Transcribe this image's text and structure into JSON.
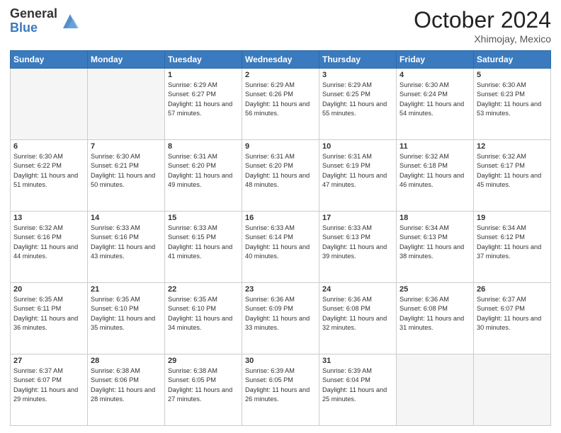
{
  "header": {
    "logo_general": "General",
    "logo_blue": "Blue",
    "month_title": "October 2024",
    "location": "Xhimojay, Mexico"
  },
  "weekdays": [
    "Sunday",
    "Monday",
    "Tuesday",
    "Wednesday",
    "Thursday",
    "Friday",
    "Saturday"
  ],
  "weeks": [
    [
      {
        "day": "",
        "info": ""
      },
      {
        "day": "",
        "info": ""
      },
      {
        "day": "1",
        "info": "Sunrise: 6:29 AM\nSunset: 6:27 PM\nDaylight: 11 hours and 57 minutes."
      },
      {
        "day": "2",
        "info": "Sunrise: 6:29 AM\nSunset: 6:26 PM\nDaylight: 11 hours and 56 minutes."
      },
      {
        "day": "3",
        "info": "Sunrise: 6:29 AM\nSunset: 6:25 PM\nDaylight: 11 hours and 55 minutes."
      },
      {
        "day": "4",
        "info": "Sunrise: 6:30 AM\nSunset: 6:24 PM\nDaylight: 11 hours and 54 minutes."
      },
      {
        "day": "5",
        "info": "Sunrise: 6:30 AM\nSunset: 6:23 PM\nDaylight: 11 hours and 53 minutes."
      }
    ],
    [
      {
        "day": "6",
        "info": "Sunrise: 6:30 AM\nSunset: 6:22 PM\nDaylight: 11 hours and 51 minutes."
      },
      {
        "day": "7",
        "info": "Sunrise: 6:30 AM\nSunset: 6:21 PM\nDaylight: 11 hours and 50 minutes."
      },
      {
        "day": "8",
        "info": "Sunrise: 6:31 AM\nSunset: 6:20 PM\nDaylight: 11 hours and 49 minutes."
      },
      {
        "day": "9",
        "info": "Sunrise: 6:31 AM\nSunset: 6:20 PM\nDaylight: 11 hours and 48 minutes."
      },
      {
        "day": "10",
        "info": "Sunrise: 6:31 AM\nSunset: 6:19 PM\nDaylight: 11 hours and 47 minutes."
      },
      {
        "day": "11",
        "info": "Sunrise: 6:32 AM\nSunset: 6:18 PM\nDaylight: 11 hours and 46 minutes."
      },
      {
        "day": "12",
        "info": "Sunrise: 6:32 AM\nSunset: 6:17 PM\nDaylight: 11 hours and 45 minutes."
      }
    ],
    [
      {
        "day": "13",
        "info": "Sunrise: 6:32 AM\nSunset: 6:16 PM\nDaylight: 11 hours and 44 minutes."
      },
      {
        "day": "14",
        "info": "Sunrise: 6:33 AM\nSunset: 6:16 PM\nDaylight: 11 hours and 43 minutes."
      },
      {
        "day": "15",
        "info": "Sunrise: 6:33 AM\nSunset: 6:15 PM\nDaylight: 11 hours and 41 minutes."
      },
      {
        "day": "16",
        "info": "Sunrise: 6:33 AM\nSunset: 6:14 PM\nDaylight: 11 hours and 40 minutes."
      },
      {
        "day": "17",
        "info": "Sunrise: 6:33 AM\nSunset: 6:13 PM\nDaylight: 11 hours and 39 minutes."
      },
      {
        "day": "18",
        "info": "Sunrise: 6:34 AM\nSunset: 6:13 PM\nDaylight: 11 hours and 38 minutes."
      },
      {
        "day": "19",
        "info": "Sunrise: 6:34 AM\nSunset: 6:12 PM\nDaylight: 11 hours and 37 minutes."
      }
    ],
    [
      {
        "day": "20",
        "info": "Sunrise: 6:35 AM\nSunset: 6:11 PM\nDaylight: 11 hours and 36 minutes."
      },
      {
        "day": "21",
        "info": "Sunrise: 6:35 AM\nSunset: 6:10 PM\nDaylight: 11 hours and 35 minutes."
      },
      {
        "day": "22",
        "info": "Sunrise: 6:35 AM\nSunset: 6:10 PM\nDaylight: 11 hours and 34 minutes."
      },
      {
        "day": "23",
        "info": "Sunrise: 6:36 AM\nSunset: 6:09 PM\nDaylight: 11 hours and 33 minutes."
      },
      {
        "day": "24",
        "info": "Sunrise: 6:36 AM\nSunset: 6:08 PM\nDaylight: 11 hours and 32 minutes."
      },
      {
        "day": "25",
        "info": "Sunrise: 6:36 AM\nSunset: 6:08 PM\nDaylight: 11 hours and 31 minutes."
      },
      {
        "day": "26",
        "info": "Sunrise: 6:37 AM\nSunset: 6:07 PM\nDaylight: 11 hours and 30 minutes."
      }
    ],
    [
      {
        "day": "27",
        "info": "Sunrise: 6:37 AM\nSunset: 6:07 PM\nDaylight: 11 hours and 29 minutes."
      },
      {
        "day": "28",
        "info": "Sunrise: 6:38 AM\nSunset: 6:06 PM\nDaylight: 11 hours and 28 minutes."
      },
      {
        "day": "29",
        "info": "Sunrise: 6:38 AM\nSunset: 6:05 PM\nDaylight: 11 hours and 27 minutes."
      },
      {
        "day": "30",
        "info": "Sunrise: 6:39 AM\nSunset: 6:05 PM\nDaylight: 11 hours and 26 minutes."
      },
      {
        "day": "31",
        "info": "Sunrise: 6:39 AM\nSunset: 6:04 PM\nDaylight: 11 hours and 25 minutes."
      },
      {
        "day": "",
        "info": ""
      },
      {
        "day": "",
        "info": ""
      }
    ]
  ]
}
